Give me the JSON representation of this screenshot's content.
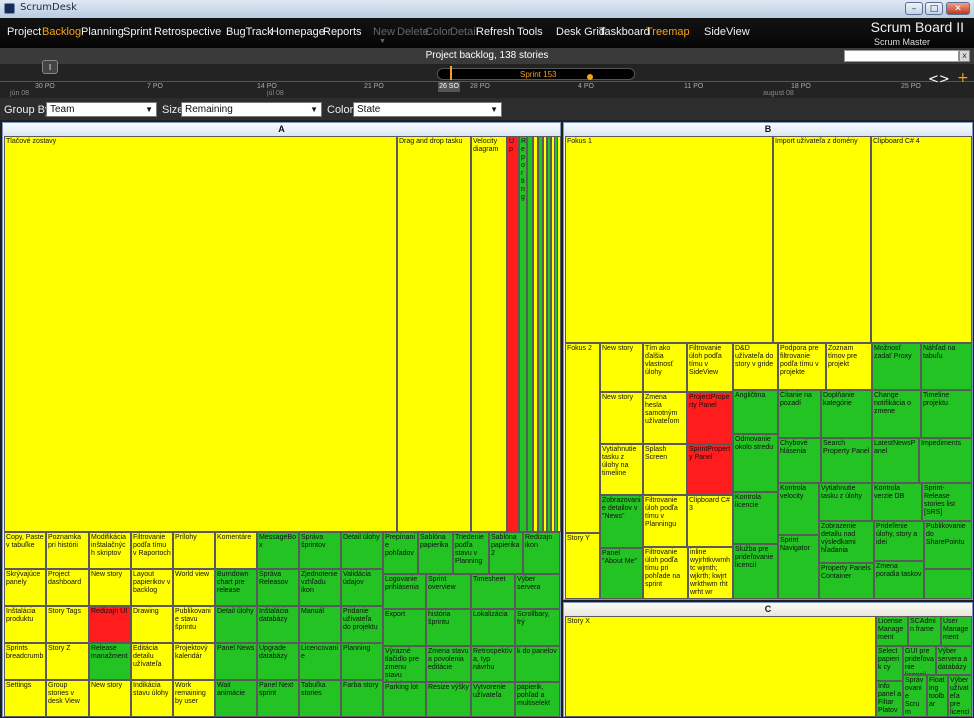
{
  "window": {
    "title": "ScrumDesk",
    "min": "–",
    "max": "□",
    "close": "✕"
  },
  "menu": {
    "project": "Project",
    "backlog": "Backlog",
    "planning": "Planning",
    "sprint": "Sprint",
    "retrospective": "Retrospective",
    "bugtrack": "BugTrack",
    "homepage": "Homepage",
    "reports": "Reports",
    "new": "New",
    "delete": "Delete",
    "color": "Color",
    "detail": "Detail",
    "refresh": "Refresh",
    "tools": "Tools",
    "deskgrid": "Desk Grid",
    "taskboard": "Taskboard",
    "treemap": "Treemap",
    "sideview": "SideView"
  },
  "board": {
    "title": "Scrum Board II",
    "role": "Scrum Master"
  },
  "backlog": {
    "title": "Project backlog,  138 stories",
    "search_close": "x"
  },
  "timeline": {
    "marker": "I",
    "sprint_label": "Sprint 153",
    "today": "26 SO",
    "ticks": [
      "30 PO",
      "7 PO",
      "14 PO",
      "21 PO",
      "28 PO",
      "4 PO",
      "11 PO",
      "18 PO",
      "25 PO"
    ],
    "months": [
      "jún 08",
      "júl 08",
      "august 08"
    ],
    "nav": "<>",
    "plus": "+"
  },
  "toolbar": {
    "groupby_label": "Group By",
    "groupby_value": "Team",
    "size_label": "Size",
    "size_value": "Remaining",
    "color_label": "Color",
    "color_value": "State",
    "arrow": "▼"
  },
  "panels": {
    "a": "A",
    "b": "B",
    "c": "C"
  },
  "tiles": {
    "a01": "Tlačové zostavy",
    "a02": "Drag and drop tasku",
    "a03": "Velocity diagram",
    "a04": "Up",
    "a05": "Reporting",
    "a10": "Copy, Paste v tabuľke",
    "a11": "Poznamka pri histórii",
    "a12": "Modifikácia inštalačných skriptov",
    "a13": "Filtrovanie podľa tímu v Raportoch",
    "a14": "Prílohy",
    "a15": "Komentáre",
    "a16": "MessageBox",
    "a17": "Správa šprintov",
    "a18": "Detail úlohy",
    "a20": "Skrývajúce panely",
    "a21": "Project dashboard",
    "a22": "New story",
    "a23": "Layout papierikov v backlog",
    "a24": "World view",
    "a25": "Burndown chart pre release",
    "a26": "Správa Releasov",
    "a27": "Zjednotenie vzhľadu ikon",
    "a28": "Validácia údajov",
    "a30": "Inštalácia produktu",
    "a31": "Story Tags",
    "a32": "Redizajn UI",
    "a33": "Drawing",
    "a34": "Publikovanie stavu šprintu",
    "a35": "Detail úlohy",
    "a36": "Inštalácia databázy",
    "a37": "Manuál",
    "a38": "Pridanie užívateľa do projektu",
    "a40": "Sprints breadcrumb",
    "a41": "Story Z",
    "a42": "Release manažment",
    "a43": "Editácia detailu užívateľa",
    "a44": "Projektový kalendár",
    "a45": "Panel News",
    "a46": "Upgrade databázy",
    "a47": "Licencovanie",
    "a48": "Planning",
    "a50": "Settings",
    "a51": "Group stories v desk View",
    "a52": "New story",
    "a53": "Indikácia stavu úlohy",
    "a54": "Work remaining by user",
    "a55": "Wait animácie",
    "a56": "Panel Next sprint",
    "a57": "Tabuľka stories",
    "a58": "Farba story",
    "a60": "Prepínanie pohľadov",
    "a61": "Šablóna papierika",
    "a62": "Triedenie podľa stavu v Planning",
    "a63": "Šablóna papierika 2",
    "a64": "Redizajn ikon",
    "a65": "Logovanie prihlásenia",
    "a66": "Sprint overview",
    "a67": "Timesheet",
    "a68": "Výber servera",
    "a69": "Export",
    "a70": "história šprintu",
    "a71": "Lokalizácia",
    "a72": "Scrollbary, frý",
    "a73": "Výrazné tlačidlo pre zmenu stavu šprintu",
    "a74": "Zmena stavu a povolenia editácie",
    "a75": "Retrospektíva, typ návrhu",
    "a76": "k do panelov",
    "a77": "Parking lot",
    "a78": "Resize výšky",
    "a79": "Vytvorenie užívateľa",
    "a80": "papierik, pohľad a multiselekt",
    "b01": "Fokus 1",
    "b02": "Import užívateľa z domény",
    "b03": "Clipboard C# 4",
    "b10": "Fokus 2",
    "b11": "New story",
    "b12": "Tím ako ďalšia vlastnosť úlohy",
    "b13": "Filtrovanie úloh podľa tímu v SideView",
    "b14": "D&D užívateľa do story v gride",
    "b15": "Podpora pre filtrovanie podľa tímu v projekte",
    "b16": "Zoznam tímov pre projekt",
    "b17": "Možnosť zadať Proxy",
    "b18": "Náhľad na tabuľu",
    "b20": "New story",
    "b21": "Zmena hesla samotným užívateľom",
    "b22": "ProjectProperty Panel",
    "b23": "Angličtina",
    "b24": "Čítanie na pozadí",
    "b25": "Doplňanie kategórie",
    "b26": "Change notifikácia o zmene",
    "b27": "Timeline projektu",
    "b30": "Vytiahnutie tasku z úlohy na timeline",
    "b31": "Splash Screen",
    "b32": "SprintProperty Panel",
    "b33": "Chybové hlásenia",
    "b34": "Odmovanie okolo stredu",
    "b35": "Search Property Panel",
    "b36": "LatestNewsPanel",
    "b37": "Impediments",
    "b40": "Zobrazovanie detailov v \"News\"",
    "b41": "Filtrovanie úloh podľa tímu v Planningu",
    "b42": "Clipboard C# 3",
    "b43": "Kontrola licencie",
    "b44": "Kontrola velocity",
    "b45": "Vytiahnutie tasku z úlohy",
    "b46": "Kontrola verzie DB",
    "b47": "Sprint-Release stories list [SRS]",
    "b48": "Zobrazenie detailu nad výsledkami hľadania",
    "b49": "Prideľenie úlohy, story a idei",
    "b50": "Publikovanie do SharePointu",
    "b51": "Story Y",
    "b52": "Panel \"About Me\"",
    "b53": "Filtrovanie úloh podľa tímu pri pohľade na sprint",
    "b54": "inline wyjrhtkvwmhtc wjmth; wjkrth; kwjrt wrkthwm rht wrht wr",
    "b55": "Služba pre prideľovanie licencií",
    "b56": "Sprint Navigator",
    "b57": "Property Panels Container",
    "b58": "Zmena poradia taskov",
    "c01": "Story X",
    "c02": "License Management",
    "c03": "SCAdmin frame",
    "c04": "User Management",
    "c05": "Select papierik cy",
    "c06": "GUI pre prideľovanie licencií",
    "c07": "Výber servera a databázy",
    "c08": "Info panel a Filtar Platov",
    "c09": "Správovanie Scrum Board",
    "c10": "Floating toolbar",
    "c11": "Výber užívateľa pre licenciu"
  }
}
